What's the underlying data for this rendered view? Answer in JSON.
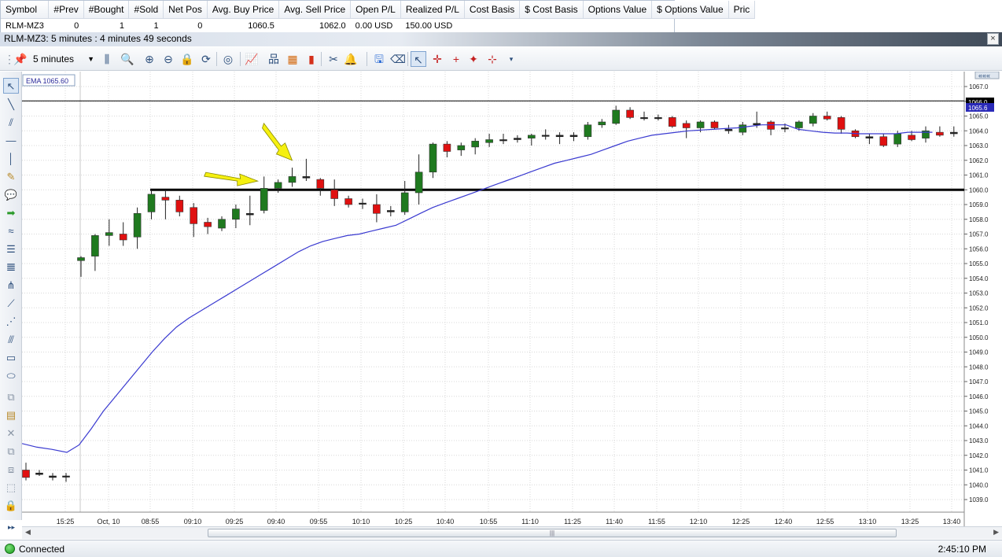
{
  "positions": {
    "columns": [
      "Symbol",
      "#Prev",
      "#Bought",
      "#Sold",
      "Net Pos",
      "Avg. Buy Price",
      "Avg. Sell Price",
      "Open P/L",
      "Realized P/L",
      "Cost Basis",
      "$ Cost Basis",
      "Options Value",
      "$ Options Value",
      "Pric"
    ],
    "row": [
      "RLM-MZ3",
      "0",
      "1",
      "1",
      "0",
      "1060.5",
      "1062.0",
      "0.00 USD",
      "150.00 USD",
      "",
      "",
      "",
      "",
      ""
    ]
  },
  "window": {
    "title": "RLM-MZ3: 5 minutes : 4 minutes 49 seconds",
    "close_label": "×"
  },
  "toolbar": {
    "interval": "5 minutes"
  },
  "chart": {
    "ema_label": "EMA  1065.60",
    "price_ticks": [
      "1067.0",
      "1066.0",
      "1065.0",
      "1064.0",
      "1063.0",
      "1062.0",
      "1061.0",
      "1060.0",
      "1059.0",
      "1058.0",
      "1057.0",
      "1056.0",
      "1055.0",
      "1054.0",
      "1053.0",
      "1052.0",
      "1051.0",
      "1050.0",
      "1049.0",
      "1048.0",
      "1047.0",
      "1046.0",
      "1045.0",
      "1044.0",
      "1043.0",
      "1042.0",
      "1041.0",
      "1040.0",
      "1039.0"
    ],
    "price_tag_upper": "1066.0",
    "price_tag_ema": "1065.6",
    "time_labels": [
      "15:25",
      "Oct, 10",
      "08:55",
      "09:10",
      "09:25",
      "09:40",
      "09:55",
      "10:10",
      "10:25",
      "10:40",
      "10:55",
      "11:10",
      "11:25",
      "11:40",
      "11:55",
      "12:10",
      "12:25",
      "12:40",
      "12:55",
      "13:10",
      "13:25",
      "13:40"
    ],
    "colors": {
      "up": "#1f7a1f",
      "down": "#e01010",
      "ema": "#3a3ad0",
      "arrow": "#f5f010",
      "grid": "#d8d8d8"
    }
  },
  "chart_data": {
    "type": "candlestick",
    "series_name": "RLM-MZ3",
    "interval": "5 minutes",
    "ylim": [
      1038.5,
      1067.5
    ],
    "candles": [
      {
        "o": 1041.0,
        "h": 1041.5,
        "l": 1040.3,
        "c": 1040.5
      },
      {
        "o": 1040.8,
        "h": 1041.0,
        "l": 1040.6,
        "c": 1040.7
      },
      {
        "o": 1040.6,
        "h": 1040.8,
        "l": 1040.3,
        "c": 1040.5
      },
      {
        "o": 1040.6,
        "h": 1040.8,
        "l": 1040.2,
        "c": 1040.6
      },
      {
        "o": 1055.2,
        "h": 1055.5,
        "l": 1054.1,
        "c": 1055.4
      },
      {
        "o": 1055.5,
        "h": 1057.0,
        "l": 1054.5,
        "c": 1056.9
      },
      {
        "o": 1056.9,
        "h": 1058.0,
        "l": 1056.2,
        "c": 1057.1
      },
      {
        "o": 1057.0,
        "h": 1057.8,
        "l": 1056.2,
        "c": 1056.6
      },
      {
        "o": 1056.8,
        "h": 1058.8,
        "l": 1056.0,
        "c": 1058.4
      },
      {
        "o": 1058.5,
        "h": 1060.0,
        "l": 1058.0,
        "c": 1059.7
      },
      {
        "o": 1059.5,
        "h": 1060.0,
        "l": 1058.0,
        "c": 1059.3
      },
      {
        "o": 1059.3,
        "h": 1059.6,
        "l": 1058.2,
        "c": 1058.5
      },
      {
        "o": 1058.8,
        "h": 1059.1,
        "l": 1056.8,
        "c": 1057.7
      },
      {
        "o": 1057.8,
        "h": 1058.1,
        "l": 1057.0,
        "c": 1057.5
      },
      {
        "o": 1057.4,
        "h": 1058.2,
        "l": 1057.2,
        "c": 1058.0
      },
      {
        "o": 1058.0,
        "h": 1059.0,
        "l": 1057.4,
        "c": 1058.7
      },
      {
        "o": 1058.3,
        "h": 1059.6,
        "l": 1057.6,
        "c": 1058.4
      },
      {
        "o": 1058.6,
        "h": 1060.9,
        "l": 1058.4,
        "c": 1060.1
      },
      {
        "o": 1060.1,
        "h": 1060.7,
        "l": 1059.8,
        "c": 1060.5
      },
      {
        "o": 1060.5,
        "h": 1061.5,
        "l": 1060.2,
        "c": 1060.9
      },
      {
        "o": 1060.9,
        "h": 1062.1,
        "l": 1060.6,
        "c": 1060.8
      },
      {
        "o": 1060.7,
        "h": 1060.8,
        "l": 1059.6,
        "c": 1060.1
      },
      {
        "o": 1060.0,
        "h": 1060.7,
        "l": 1058.9,
        "c": 1059.4
      },
      {
        "o": 1059.4,
        "h": 1059.6,
        "l": 1058.8,
        "c": 1059.0
      },
      {
        "o": 1059.1,
        "h": 1059.4,
        "l": 1058.7,
        "c": 1059.1
      },
      {
        "o": 1059.0,
        "h": 1059.7,
        "l": 1057.8,
        "c": 1058.4
      },
      {
        "o": 1058.6,
        "h": 1058.9,
        "l": 1058.2,
        "c": 1058.5
      },
      {
        "o": 1058.5,
        "h": 1060.6,
        "l": 1058.3,
        "c": 1059.8
      },
      {
        "o": 1059.8,
        "h": 1062.4,
        "l": 1059.0,
        "c": 1061.2
      },
      {
        "o": 1061.2,
        "h": 1063.2,
        "l": 1060.8,
        "c": 1063.1
      },
      {
        "o": 1063.1,
        "h": 1063.3,
        "l": 1062.2,
        "c": 1062.6
      },
      {
        "o": 1062.7,
        "h": 1063.2,
        "l": 1062.3,
        "c": 1063.0
      },
      {
        "o": 1062.9,
        "h": 1063.5,
        "l": 1062.4,
        "c": 1063.3
      },
      {
        "o": 1063.2,
        "h": 1063.8,
        "l": 1062.9,
        "c": 1063.4
      },
      {
        "o": 1063.4,
        "h": 1063.8,
        "l": 1063.1,
        "c": 1063.4
      },
      {
        "o": 1063.4,
        "h": 1063.7,
        "l": 1063.2,
        "c": 1063.5
      },
      {
        "o": 1063.5,
        "h": 1063.8,
        "l": 1063.0,
        "c": 1063.7
      },
      {
        "o": 1063.7,
        "h": 1064.1,
        "l": 1063.4,
        "c": 1063.7
      },
      {
        "o": 1063.7,
        "h": 1063.9,
        "l": 1063.1,
        "c": 1063.6
      },
      {
        "o": 1063.6,
        "h": 1063.9,
        "l": 1063.3,
        "c": 1063.7
      },
      {
        "o": 1063.6,
        "h": 1064.6,
        "l": 1063.4,
        "c": 1064.4
      },
      {
        "o": 1064.4,
        "h": 1064.8,
        "l": 1064.2,
        "c": 1064.6
      },
      {
        "o": 1064.5,
        "h": 1065.7,
        "l": 1064.4,
        "c": 1065.4
      },
      {
        "o": 1065.4,
        "h": 1065.6,
        "l": 1064.8,
        "c": 1064.9
      },
      {
        "o": 1064.9,
        "h": 1065.3,
        "l": 1064.7,
        "c": 1064.9
      },
      {
        "o": 1064.9,
        "h": 1065.1,
        "l": 1064.7,
        "c": 1064.9
      },
      {
        "o": 1064.9,
        "h": 1065.0,
        "l": 1064.2,
        "c": 1064.3
      },
      {
        "o": 1064.5,
        "h": 1064.7,
        "l": 1063.5,
        "c": 1064.2
      },
      {
        "o": 1064.2,
        "h": 1064.7,
        "l": 1063.9,
        "c": 1064.6
      },
      {
        "o": 1064.6,
        "h": 1064.7,
        "l": 1064.1,
        "c": 1064.2
      },
      {
        "o": 1064.1,
        "h": 1064.4,
        "l": 1063.8,
        "c": 1064.0
      },
      {
        "o": 1063.9,
        "h": 1064.6,
        "l": 1063.7,
        "c": 1064.4
      },
      {
        "o": 1064.4,
        "h": 1065.3,
        "l": 1064.2,
        "c": 1064.5
      },
      {
        "o": 1064.6,
        "h": 1064.7,
        "l": 1063.7,
        "c": 1064.1
      },
      {
        "o": 1064.2,
        "h": 1064.5,
        "l": 1063.9,
        "c": 1064.2
      },
      {
        "o": 1064.2,
        "h": 1064.7,
        "l": 1064.0,
        "c": 1064.6
      },
      {
        "o": 1064.5,
        "h": 1065.2,
        "l": 1064.3,
        "c": 1065.0
      },
      {
        "o": 1065.0,
        "h": 1065.3,
        "l": 1064.7,
        "c": 1064.8
      },
      {
        "o": 1064.9,
        "h": 1065.0,
        "l": 1063.8,
        "c": 1064.1
      },
      {
        "o": 1064.0,
        "h": 1064.1,
        "l": 1063.5,
        "c": 1063.6
      },
      {
        "o": 1063.6,
        "h": 1063.8,
        "l": 1063.1,
        "c": 1063.5
      },
      {
        "o": 1063.6,
        "h": 1063.8,
        "l": 1062.9,
        "c": 1063.0
      },
      {
        "o": 1063.1,
        "h": 1064.0,
        "l": 1062.9,
        "c": 1063.8
      },
      {
        "o": 1063.7,
        "h": 1064.0,
        "l": 1063.3,
        "c": 1063.4
      },
      {
        "o": 1063.5,
        "h": 1064.3,
        "l": 1063.2,
        "c": 1064.0
      },
      {
        "o": 1063.9,
        "h": 1064.3,
        "l": 1063.6,
        "c": 1063.7
      },
      {
        "o": 1063.8,
        "h": 1064.3,
        "l": 1063.6,
        "c": 1063.9
      }
    ],
    "ema": [
      1042.8,
      1042.55,
      1042.4,
      1042.2,
      1042.7,
      1043.8,
      1045.0,
      1046.0,
      1047.0,
      1048.0,
      1049.0,
      1049.9,
      1050.7,
      1051.3,
      1051.8,
      1052.3,
      1052.8,
      1053.3,
      1053.8,
      1054.3,
      1054.8,
      1055.3,
      1055.8,
      1056.2,
      1056.5,
      1056.7,
      1056.9,
      1057.0,
      1057.2,
      1057.4,
      1057.6,
      1058.0,
      1058.4,
      1058.8,
      1059.1,
      1059.4,
      1059.7,
      1060.0,
      1060.3,
      1060.6,
      1060.9,
      1061.2,
      1061.5,
      1061.8,
      1062.0,
      1062.2,
      1062.4,
      1062.7,
      1063.0,
      1063.3,
      1063.5,
      1063.7,
      1063.8,
      1063.9,
      1064.0,
      1064.05,
      1064.1,
      1064.15,
      1064.2,
      1064.3,
      1064.4,
      1064.4,
      1064.4,
      1064.1,
      1064.0,
      1063.9,
      1063.85,
      1063.85,
      1063.8,
      1063.8,
      1063.8,
      1063.8,
      1063.9,
      1063.9,
      1063.9
    ],
    "horizontal_lines": [
      1066.0,
      1060.0
    ],
    "arrows": [
      {
        "candle": 17,
        "direction": "right"
      },
      {
        "candle": 19,
        "direction": "down"
      }
    ]
  },
  "status": {
    "connection": "Connected",
    "clock": "2:45:10 PM"
  }
}
